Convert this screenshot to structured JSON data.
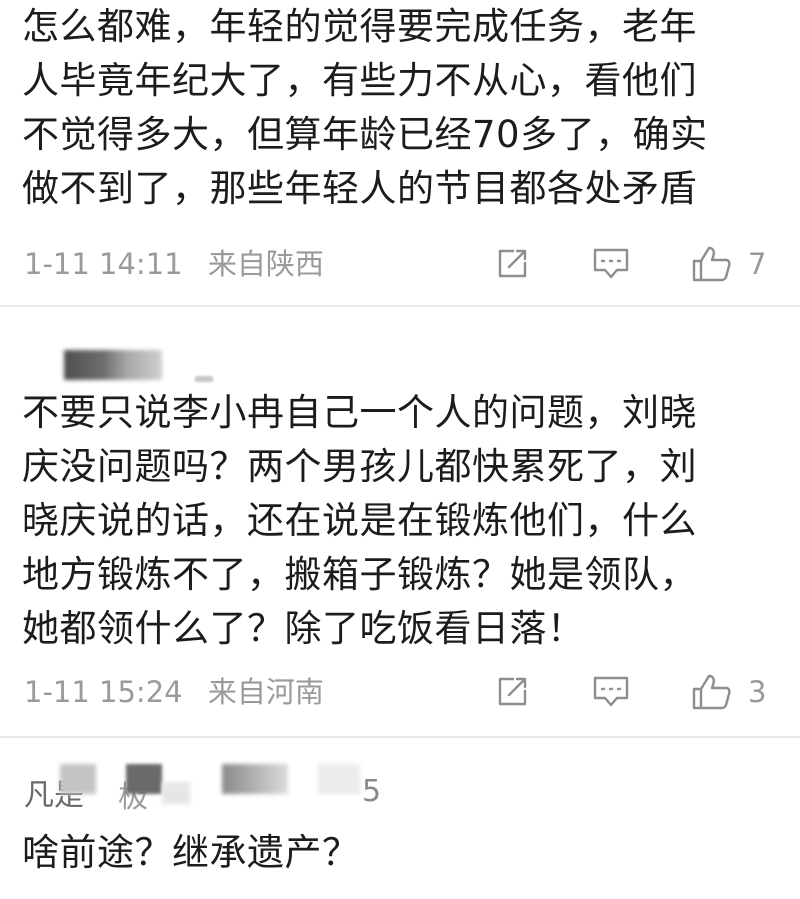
{
  "comments": [
    {
      "text": "怎么都难，年轻的觉得要完成任务，老年\n人毕竟年纪大了，有些力不从心，看他们\n不觉得多大，但算年龄已经70多了，确实\n做不到了，那些年轻人的节目都各处矛盾",
      "time": "1-11 14:11",
      "location": "来自陕西",
      "likes": "7"
    },
    {
      "text": "不要只说李小冉自己一个人的问题，刘晓\n庆没问题吗？两个男孩儿都快累死了，刘\n晓庆说的话，还在说是在锻炼他们，什么\n地方锻炼不了，搬箱子锻炼？她是领队，\n她都领什么了？除了吃饭看日落！",
      "time": "1-11 15:24",
      "location": "来自河南",
      "likes": "3"
    },
    {
      "username_fragments": [
        "凡是",
        "极",
        "5"
      ],
      "text": "啥前途？继承遗产？"
    }
  ],
  "icons": {
    "share": "share-icon",
    "reply": "comment-icon",
    "like": "thumbs-up-icon"
  },
  "colors": {
    "meta": "#9a9a9a",
    "text": "#1c1c1c",
    "divider": "#e8e8e8"
  }
}
